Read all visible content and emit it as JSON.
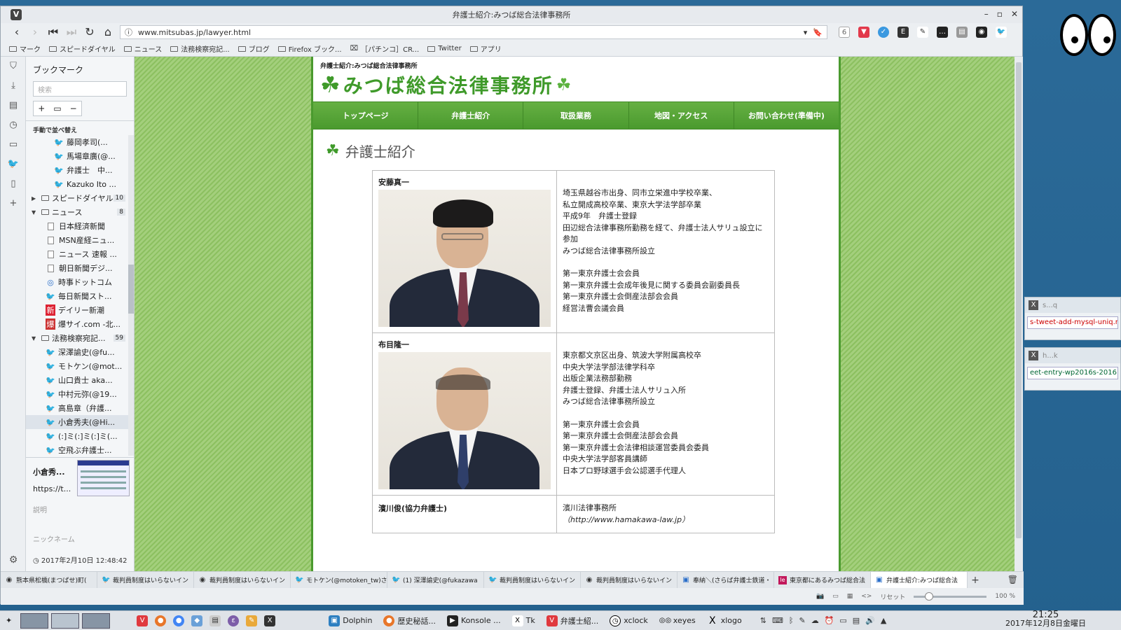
{
  "window": {
    "title": "弁護士紹介:みつば総合法律事務所",
    "url": "www.mitsubas.jp/lawyer.html"
  },
  "bookmarks_bar": [
    "マーク",
    "スピードダイヤル",
    "ニュース",
    "法務検察宛記...",
    "ブログ",
    "Firefox ブック...",
    "［パチンコ］CR...",
    "Twitter",
    "アプリ"
  ],
  "panel": {
    "title": "ブックマーク",
    "search_placeholder": "検索",
    "sort_label": "手動で並べ替え",
    "tree": [
      {
        "label": "藤岡孝司(...",
        "icon": "twitter",
        "indent": 3
      },
      {
        "label": "馬場章廣(@...",
        "icon": "twitter",
        "indent": 3
      },
      {
        "label": "弁護士　中...",
        "icon": "twitter",
        "indent": 3
      },
      {
        "label": "Kazuko Ito ...",
        "icon": "twitter",
        "indent": 3
      },
      {
        "label": "スピードダイヤル",
        "icon": "folder",
        "indent": 1,
        "count": "10",
        "tri": "▶"
      },
      {
        "label": "ニュース",
        "icon": "folder",
        "indent": 1,
        "count": "8",
        "tri": "▼"
      },
      {
        "label": "日本経済新聞",
        "icon": "page",
        "indent": 2
      },
      {
        "label": "MSN産経ニュ...",
        "icon": "page",
        "indent": 2
      },
      {
        "label": "ニュース 速報 ...",
        "icon": "page",
        "indent": 2
      },
      {
        "label": "朝日新聞デジ...",
        "icon": "page",
        "indent": 2
      },
      {
        "label": "時事ドットコム",
        "icon": "jiji",
        "indent": 2
      },
      {
        "label": "毎日新聞スト...",
        "icon": "twitter",
        "indent": 2
      },
      {
        "label": "デイリー新潮",
        "icon": "daily",
        "indent": 2
      },
      {
        "label": "爆サイ.com -北...",
        "icon": "bakusai",
        "indent": 2
      },
      {
        "label": "法務検察宛記...",
        "icon": "folder",
        "indent": 1,
        "count": "59",
        "tri": "▼"
      },
      {
        "label": "深澤諭史(@fu...",
        "icon": "twitter",
        "indent": 2
      },
      {
        "label": "モトケン(@mot...",
        "icon": "twitter",
        "indent": 2
      },
      {
        "label": "山口貴士 aka...",
        "icon": "twitter",
        "indent": 2
      },
      {
        "label": "中村元弥(@19...",
        "icon": "twitter",
        "indent": 2
      },
      {
        "label": "高島章（弁護...",
        "icon": "twitter",
        "indent": 2
      },
      {
        "label": "小倉秀夫(@Hi...",
        "icon": "twitter",
        "indent": 2,
        "selected": true
      },
      {
        "label": "(:]ミ(:]ミ(:]ミ(...",
        "icon": "twitter",
        "indent": 2
      },
      {
        "label": "空飛ぶ弁護士...",
        "icon": "twitter",
        "indent": 2
      }
    ],
    "preview": {
      "title": "小倉秀...",
      "url": "https://t...",
      "desc_label": "説明",
      "nick_label": "ニックネーム",
      "date": "2017年2月10日 12:48:42"
    }
  },
  "site": {
    "crumb": "弁護士紹介:みつば総合法律事務所",
    "logo": "みつば総合法律事務所",
    "nav": [
      "トップページ",
      "弁護士紹介",
      "取扱業務",
      "地図・アクセス",
      "お問い合わせ(準備中)"
    ],
    "page_title": "弁護士紹介",
    "lawyers": [
      {
        "name": "安藤真一",
        "lines_a": [
          "埼玉県越谷市出身、同市立栄進中学校卒業、",
          "私立開成高校卒業、東京大学法学部卒業",
          "平成9年　弁護士登録",
          "田辺総合法律事務所勤務を経て、弁護士法人サリュ設立に",
          "参加",
          "みつば総合法律事務所設立"
        ],
        "lines_b": [
          "第一東京弁護士会会員",
          "第一東京弁護士会成年後見に関する委員会副委員長",
          "第一東京弁護士会倒産法部会会員",
          "経営法曹会議会員"
        ]
      },
      {
        "name": "布目隆一",
        "lines_a": [
          "東京都文京区出身、筑波大学附属高校卒",
          "中央大学法学部法律学科卒",
          "出版企業法務部勤務",
          "弁護士登録、弁護士法人サリュ入所",
          "みつば総合法律事務所設立"
        ],
        "lines_b": [
          "第一東京弁護士会会員",
          "第一東京弁護士会倒産法部会会員",
          "第一東京弁護士会法律相談運営委員会委員",
          "中央大学法学部客員講師",
          "日本プロ野球選手会公認選手代理人"
        ]
      }
    ],
    "cooperating": {
      "name": "濱川俊(協力弁護士)",
      "office": "濱川法律事務所",
      "url": "（http://www.hamakawa-law.jp）"
    }
  },
  "tabs": [
    "熊本県松橋(まつばせ)町(",
    "裁判員制度はいらないイン",
    "裁判員制度はいらないイン",
    "モトケン(@motoken_tw)さ",
    "(1) 深澤諭史(@fukazawa",
    "裁判員制度はいらないイン",
    "裁判員制度はいらないイン",
    "奉納＼(さらば弁護士鉄道・",
    "東京都にあるみつば総合法",
    "弁護士紹介:みつば総合法"
  ],
  "status": {
    "reset": "リセット",
    "zoom": "100 %"
  },
  "side_windows": [
    {
      "title": "s...q",
      "text": "s-tweet-add-mysql-uniq.rb"
    },
    {
      "title": "h...k",
      "text": "eet-entry-wp2016s-201610"
    }
  ],
  "taskbar": {
    "items": [
      "Dolphin",
      "歴史秘話...",
      "Konsole ...",
      "Tk",
      "弁護士紹...",
      "xclock",
      "xeyes",
      "xlogo"
    ],
    "time": "21:25",
    "date": "2017年12月8日金曜日"
  }
}
